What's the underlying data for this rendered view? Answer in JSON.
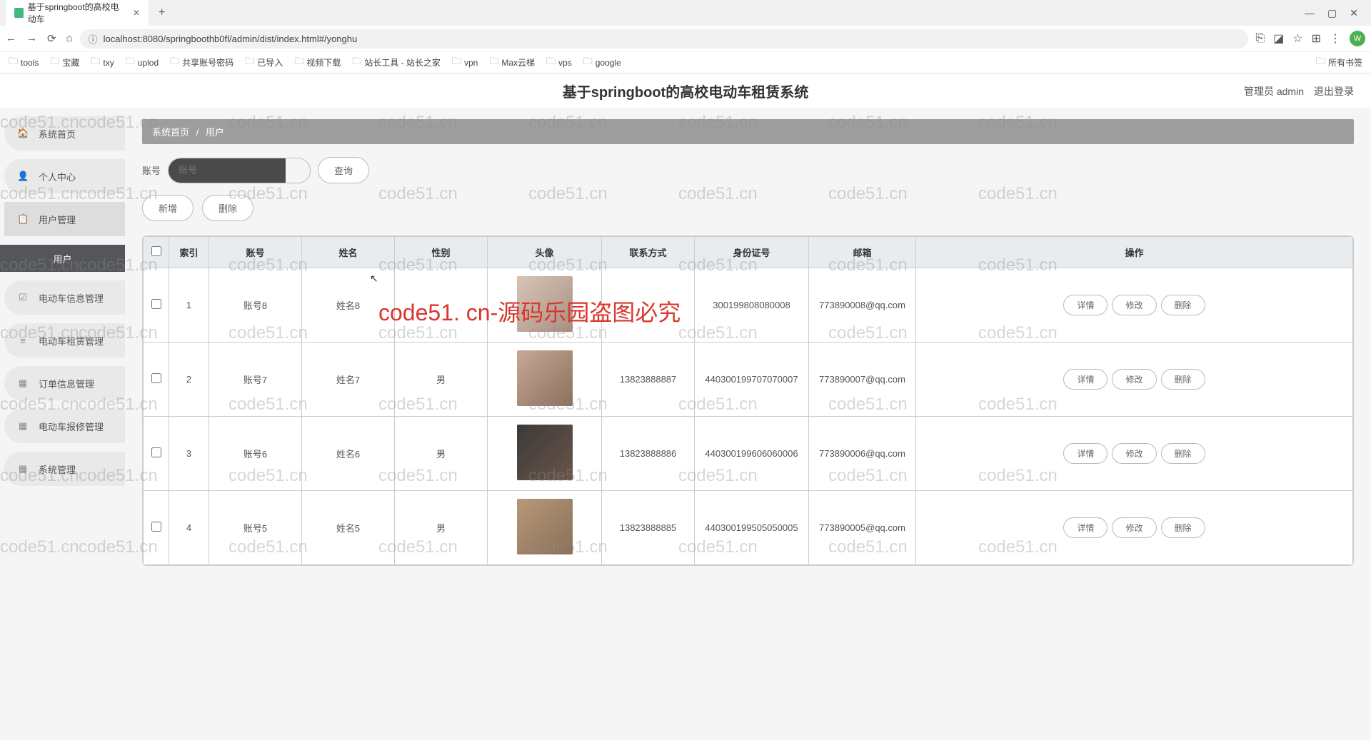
{
  "browser": {
    "tab_title": "基于springboot的高校电动车",
    "url": "localhost:8080/springboothb0fl/admin/dist/index.html#/yonghu",
    "bookmarks": [
      "tools",
      "宝藏",
      "txy",
      "uplod",
      "共享账号密码",
      "已导入",
      "视频下载",
      "站长工具 - 站长之家",
      "vpn",
      "Max云梯",
      "vps",
      "google"
    ],
    "bookmark_right": "所有书签",
    "avatar_letter": "W"
  },
  "header": {
    "title": "基于springboot的高校电动车租赁系统",
    "user_label": "管理员 admin",
    "logout": "退出登录"
  },
  "sidebar": {
    "items": [
      {
        "label": "系统首页",
        "icon": "🏠"
      },
      {
        "label": "个人中心",
        "icon": "👤"
      },
      {
        "label": "用户管理",
        "icon": "📋"
      },
      {
        "label": "电动车信息管理",
        "icon": "☑"
      },
      {
        "label": "电动车租赁管理",
        "icon": "≡"
      },
      {
        "label": "订单信息管理",
        "icon": "▦"
      },
      {
        "label": "电动车报修管理",
        "icon": "▦"
      },
      {
        "label": "系统管理",
        "icon": "▦"
      }
    ],
    "sub_active": "用户"
  },
  "breadcrumb": {
    "home": "系统首页",
    "current": "用户"
  },
  "search": {
    "label": "账号",
    "placeholder": "账号",
    "query_btn": "查询"
  },
  "actions": {
    "add": "新增",
    "delete": "删除"
  },
  "table": {
    "headers": [
      "索引",
      "账号",
      "姓名",
      "性别",
      "头像",
      "联系方式",
      "身份证号",
      "邮箱",
      "操作"
    ],
    "op_labels": {
      "detail": "详情",
      "edit": "修改",
      "delete": "删除"
    },
    "rows": [
      {
        "idx": "1",
        "account": "账号8",
        "name": "姓名8",
        "sex": "",
        "phone": "",
        "idcard": "300199808080008",
        "email": "773890008@qq.com"
      },
      {
        "idx": "2",
        "account": "账号7",
        "name": "姓名7",
        "sex": "男",
        "phone": "13823888887",
        "idcard": "440300199707070007",
        "email": "773890007@qq.com"
      },
      {
        "idx": "3",
        "account": "账号6",
        "name": "姓名6",
        "sex": "男",
        "phone": "13823888886",
        "idcard": "440300199606060006",
        "email": "773890006@qq.com"
      },
      {
        "idx": "4",
        "account": "账号5",
        "name": "姓名5",
        "sex": "男",
        "phone": "13823888885",
        "idcard": "440300199505050005",
        "email": "773890005@qq.com"
      }
    ]
  },
  "watermark": "code51.cn",
  "watermark_red": "code51. cn-源码乐园盗图必究"
}
